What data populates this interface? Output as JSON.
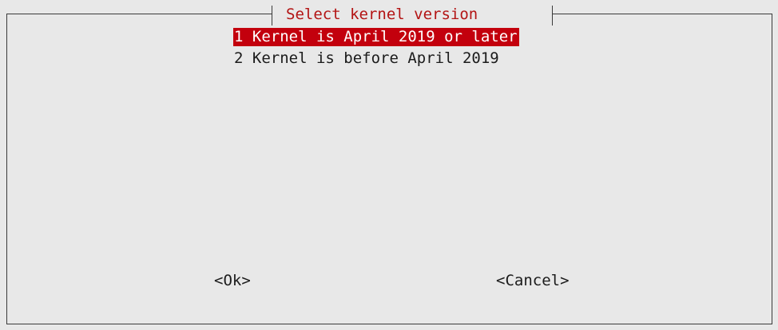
{
  "dialog": {
    "title": "Select kernel version",
    "items": [
      {
        "label": "1 Kernel is April 2019 or later",
        "selected": true
      },
      {
        "label": "2 Kernel is before April 2019",
        "selected": false
      }
    ],
    "buttons": {
      "ok": "<Ok>",
      "cancel": "<Cancel>"
    }
  },
  "colors": {
    "dialog_bg": "#e8e8e8",
    "title_color": "#b31414",
    "selection_bg": "#c3000d",
    "selection_fg": "#ffffff",
    "text": "#1b1b1b"
  }
}
